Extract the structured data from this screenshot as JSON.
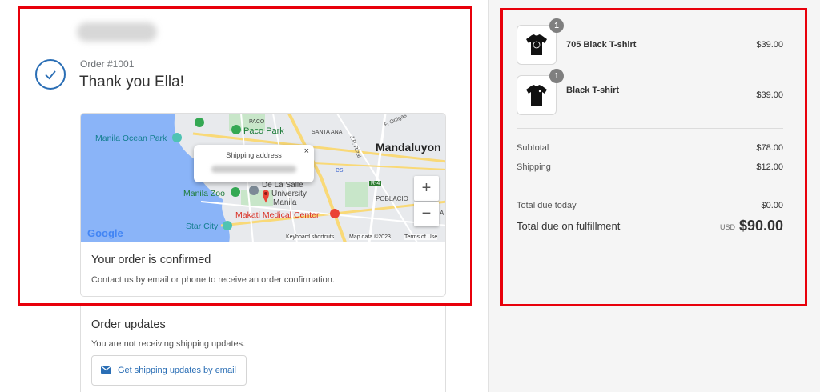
{
  "header": {
    "order_number": "Order #1001",
    "thank_you": "Thank you Ella!"
  },
  "map": {
    "popup_title": "Shipping address",
    "popup_close": "×",
    "zoom_in": "+",
    "zoom_out": "−",
    "google": "Google",
    "keyboard_shortcuts": "Keyboard shortcuts",
    "map_data": "Map data ©2023",
    "terms": "Terms of Use",
    "labels": {
      "paco": "PACO",
      "paco_park": "Paco Park",
      "santa_ana": "SANTA ANA",
      "f_ortigas": "F. Ortigas",
      "manila_ocean_park": "Manila Ocean Park",
      "mandaluyong": "Mandaluyon",
      "jp_rizal": "J.P. Rizal",
      "de_la_salle": "De La Salle",
      "university": "University",
      "manila": "Manila",
      "manila_zoo": "Manila Zoo",
      "poblacion": "POBLACIO",
      "r4": "R-4",
      "makati_medical": "Makati Medical Center",
      "star_city": "Star City",
      "a": "A",
      "es": "es"
    }
  },
  "confirmation": {
    "title": "Your order is confirmed",
    "text": "Contact us by email or phone to receive an order confirmation."
  },
  "updates": {
    "title": "Order updates",
    "text": "You are not receiving shipping updates.",
    "button_label": "Get shipping updates by email"
  },
  "items": [
    {
      "name": "705 Black T-shirt",
      "price": "$39.00",
      "qty": "1"
    },
    {
      "name": "Black T-shirt",
      "price": "$39.00",
      "qty": "1"
    }
  ],
  "summary": {
    "subtotal_label": "Subtotal",
    "subtotal": "$78.00",
    "shipping_label": "Shipping",
    "shipping": "$12.00",
    "due_today_label": "Total due today",
    "due_today": "$0.00",
    "fulfillment_label": "Total due on fulfillment",
    "currency": "USD",
    "total": "$90.00"
  },
  "colors": {
    "accent": "#2a6eb5",
    "highlight": "#e8000b",
    "map_water": "#8ab4f8",
    "map_land": "#e8eaed",
    "map_park": "#c8e6c9",
    "map_road": "#f9d977",
    "pin": "#ea4335"
  }
}
